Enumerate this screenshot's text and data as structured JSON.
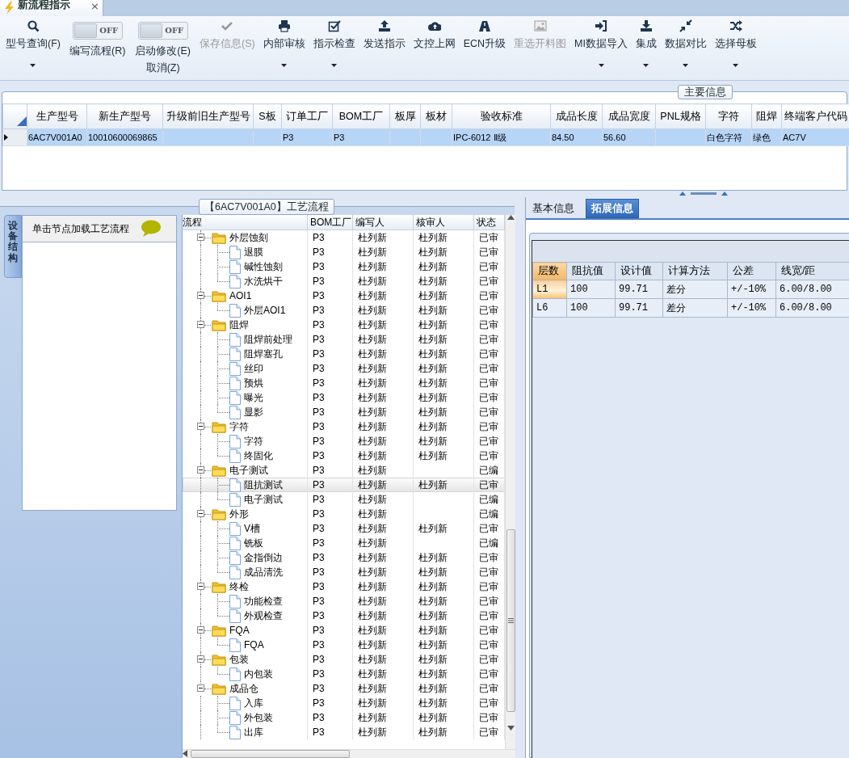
{
  "tab": {
    "title": "新流程指示",
    "close": "×"
  },
  "toolbar": [
    {
      "kind": "button",
      "label": "型号查询(F)",
      "disabled": false,
      "has_menu": true
    },
    {
      "kind": "toggle",
      "label": "编写流程(R)",
      "switch_text": "OFF",
      "on": false
    },
    {
      "kind": "toggle",
      "label": "启动修改(E)",
      "sublabel": "取消(Z)",
      "switch_text": "OFF",
      "on": false
    },
    {
      "kind": "button",
      "label": "保存信息(S)",
      "disabled": true,
      "has_menu": false
    },
    {
      "kind": "button",
      "label": "内部审核",
      "disabled": false,
      "has_menu": true
    },
    {
      "kind": "button",
      "label": "指示检查",
      "disabled": false,
      "has_menu": true
    },
    {
      "kind": "button",
      "label": "发送指示",
      "disabled": false,
      "has_menu": false
    },
    {
      "kind": "button",
      "label": "文控上网",
      "disabled": false,
      "has_menu": false
    },
    {
      "kind": "button",
      "label": "ECN升级",
      "disabled": false,
      "has_menu": false
    },
    {
      "kind": "button",
      "label": "重选开料图",
      "disabled": true,
      "has_menu": false
    },
    {
      "kind": "button",
      "label": "MI数据导入",
      "disabled": false,
      "has_menu": true
    },
    {
      "kind": "button",
      "label": "集成",
      "disabled": false,
      "has_menu": true
    },
    {
      "kind": "button",
      "label": "数据对比",
      "disabled": false,
      "has_menu": true
    },
    {
      "kind": "button",
      "label": "选择母板",
      "disabled": false,
      "has_menu": true
    }
  ],
  "main_info": {
    "title": "主要信息",
    "columns": [
      "生产型号",
      "新生产型号",
      "升级前旧生产型号",
      "S板",
      "订单工厂",
      "BOM工厂",
      "板厚",
      "板材",
      "验收标准",
      "成品长度",
      "成品宽度",
      "PNL规格",
      "字符",
      "阻焊",
      "终端客户代码"
    ],
    "rows": [
      {
        "selected": true,
        "current": true,
        "cells": [
          "6AC7V001A0",
          "10010600069865",
          null,
          null,
          "P3",
          "P3",
          null,
          null,
          "IPC-6012 Ⅱ级",
          "84.50",
          "56.60",
          null,
          "白色字符",
          "绿色",
          "AC7V"
        ]
      }
    ]
  },
  "process": {
    "title": "【6AC7V001A0】工艺流程",
    "side_tab": "设备结构",
    "hint": "单击节点加载工艺流程",
    "columns": [
      "流程",
      "BOM工厂",
      "编写人",
      "核审人",
      "状态"
    ],
    "tree": [
      {
        "name": "外层蚀刻",
        "cells": [
          "P3",
          "杜列新",
          "杜列新",
          "已审"
        ],
        "expanded": true,
        "selected": false,
        "children": [
          {
            "name": "退膜",
            "cells": [
              "P3",
              "杜列新",
              "杜列新",
              "已审"
            ],
            "selected": false
          },
          {
            "name": "碱性蚀刻",
            "cells": [
              "P3",
              "杜列新",
              "杜列新",
              "已审"
            ],
            "selected": false
          },
          {
            "name": "水洗烘干",
            "cells": [
              "P3",
              "杜列新",
              "杜列新",
              "已审"
            ],
            "selected": false
          }
        ]
      },
      {
        "name": "AOI1",
        "cells": [
          "P3",
          "杜列新",
          "杜列新",
          "已审"
        ],
        "expanded": true,
        "selected": false,
        "children": [
          {
            "name": "外层AOI1",
            "cells": [
              "P3",
              "杜列新",
              "杜列新",
              "已审"
            ],
            "selected": false
          }
        ]
      },
      {
        "name": "阻焊",
        "cells": [
          "P3",
          "杜列新",
          "杜列新",
          "已审"
        ],
        "expanded": true,
        "selected": false,
        "children": [
          {
            "name": "阻焊前处理",
            "cells": [
              "P3",
              "杜列新",
              "杜列新",
              "已审"
            ],
            "selected": false
          },
          {
            "name": "阻焊塞孔",
            "cells": [
              "P3",
              "杜列新",
              "杜列新",
              "已审"
            ],
            "selected": false
          },
          {
            "name": "丝印",
            "cells": [
              "P3",
              "杜列新",
              "杜列新",
              "已审"
            ],
            "selected": false
          },
          {
            "name": "预烘",
            "cells": [
              "P3",
              "杜列新",
              "杜列新",
              "已审"
            ],
            "selected": false
          },
          {
            "name": "曝光",
            "cells": [
              "P3",
              "杜列新",
              "杜列新",
              "已审"
            ],
            "selected": false
          },
          {
            "name": "显影",
            "cells": [
              "P3",
              "杜列新",
              "杜列新",
              "已审"
            ],
            "selected": false
          }
        ]
      },
      {
        "name": "字符",
        "cells": [
          "P3",
          "杜列新",
          "杜列新",
          "已审"
        ],
        "expanded": true,
        "selected": false,
        "children": [
          {
            "name": "字符",
            "cells": [
              "P3",
              "杜列新",
              "杜列新",
              "已审"
            ],
            "selected": false
          },
          {
            "name": "终固化",
            "cells": [
              "P3",
              "杜列新",
              "杜列新",
              "已审"
            ],
            "selected": false
          }
        ]
      },
      {
        "name": "电子测试",
        "cells": [
          "P3",
          "杜列新",
          null,
          "已编"
        ],
        "expanded": true,
        "selected": false,
        "children": [
          {
            "name": "阻抗测试",
            "cells": [
              "P3",
              "杜列新",
              "杜列新",
              "已审"
            ],
            "selected": true
          },
          {
            "name": "电子测试",
            "cells": [
              "P3",
              "杜列新",
              null,
              "已编"
            ],
            "selected": false
          }
        ]
      },
      {
        "name": "外形",
        "cells": [
          "P3",
          "杜列新",
          null,
          "已编"
        ],
        "expanded": true,
        "selected": false,
        "children": [
          {
            "name": "V槽",
            "cells": [
              "P3",
              "杜列新",
              "杜列新",
              "已审"
            ],
            "selected": false
          },
          {
            "name": "铣板",
            "cells": [
              "P3",
              "杜列新",
              null,
              "已编"
            ],
            "selected": false
          },
          {
            "name": "金指倒边",
            "cells": [
              "P3",
              "杜列新",
              "杜列新",
              "已审"
            ],
            "selected": false
          },
          {
            "name": "成品清洗",
            "cells": [
              "P3",
              "杜列新",
              "杜列新",
              "已审"
            ],
            "selected": false
          }
        ]
      },
      {
        "name": "终检",
        "cells": [
          "P3",
          "杜列新",
          "杜列新",
          "已审"
        ],
        "expanded": true,
        "selected": false,
        "children": [
          {
            "name": "功能检查",
            "cells": [
              "P3",
              "杜列新",
              "杜列新",
              "已审"
            ],
            "selected": false
          },
          {
            "name": "外观检查",
            "cells": [
              "P3",
              "杜列新",
              "杜列新",
              "已审"
            ],
            "selected": false
          }
        ]
      },
      {
        "name": "FQA",
        "cells": [
          "P3",
          "杜列新",
          "杜列新",
          "已审"
        ],
        "expanded": true,
        "selected": false,
        "children": [
          {
            "name": "FQA",
            "cells": [
              "P3",
              "杜列新",
              "杜列新",
              "已审"
            ],
            "selected": false
          }
        ]
      },
      {
        "name": "包装",
        "cells": [
          "P3",
          "杜列新",
          "杜列新",
          "已审"
        ],
        "expanded": true,
        "selected": false,
        "children": [
          {
            "name": "内包装",
            "cells": [
              "P3",
              "杜列新",
              "杜列新",
              "已审"
            ],
            "selected": false
          }
        ]
      },
      {
        "name": "成品仓",
        "cells": [
          "P3",
          "杜列新",
          "杜列新",
          "已审"
        ],
        "expanded": true,
        "selected": false,
        "children": [
          {
            "name": "入库",
            "cells": [
              "P3",
              "杜列新",
              "杜列新",
              "已审"
            ],
            "selected": false
          },
          {
            "name": "外包装",
            "cells": [
              "P3",
              "杜列新",
              "杜列新",
              "已审"
            ],
            "selected": false
          },
          {
            "name": "出库",
            "cells": [
              "P3",
              "杜列新",
              "杜列新",
              "已审"
            ],
            "selected": false
          }
        ]
      }
    ]
  },
  "detail": {
    "tabs": [
      {
        "label": "基本信息",
        "selected": false
      },
      {
        "label": "拓展信息",
        "selected": true
      }
    ],
    "columns": [
      "层数",
      "阻抗值",
      "设计值",
      "计算方法",
      "公差",
      "线宽/距"
    ],
    "rows": [
      {
        "selected": true,
        "cells": [
          "L1",
          "100",
          "99.71",
          "差分",
          "+/-10%",
          "6.00/8.00"
        ]
      },
      {
        "selected": false,
        "cells": [
          "L6",
          "100",
          "99.71",
          "差分",
          "+/-10%",
          "6.00/8.00"
        ]
      }
    ]
  }
}
